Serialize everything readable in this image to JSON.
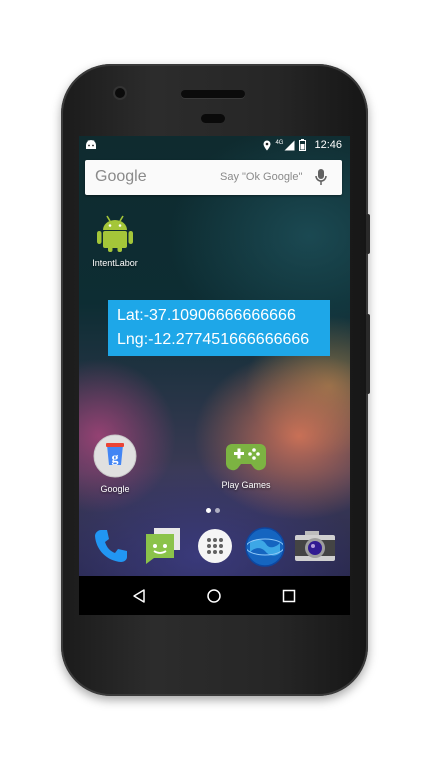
{
  "status_bar": {
    "time": "12:46",
    "network": "4G",
    "icons": [
      "android-notification-icon",
      "location-icon",
      "signal-icon",
      "battery-icon"
    ]
  },
  "search": {
    "logo": "Google",
    "hint": "Say \"Ok Google\""
  },
  "apps": {
    "intent_labor": "IntentLabor",
    "google": "Google",
    "play_games": "Play Games"
  },
  "location": {
    "lat": "Lat:-37.10906666666666",
    "lng": "Lng:-12.277451666666666"
  },
  "dock": [
    "phone-app-icon",
    "messaging-app-icon",
    "app-drawer-icon",
    "browser-app-icon",
    "camera-app-icon"
  ],
  "nav": [
    "back-icon",
    "home-icon",
    "recents-icon"
  ]
}
